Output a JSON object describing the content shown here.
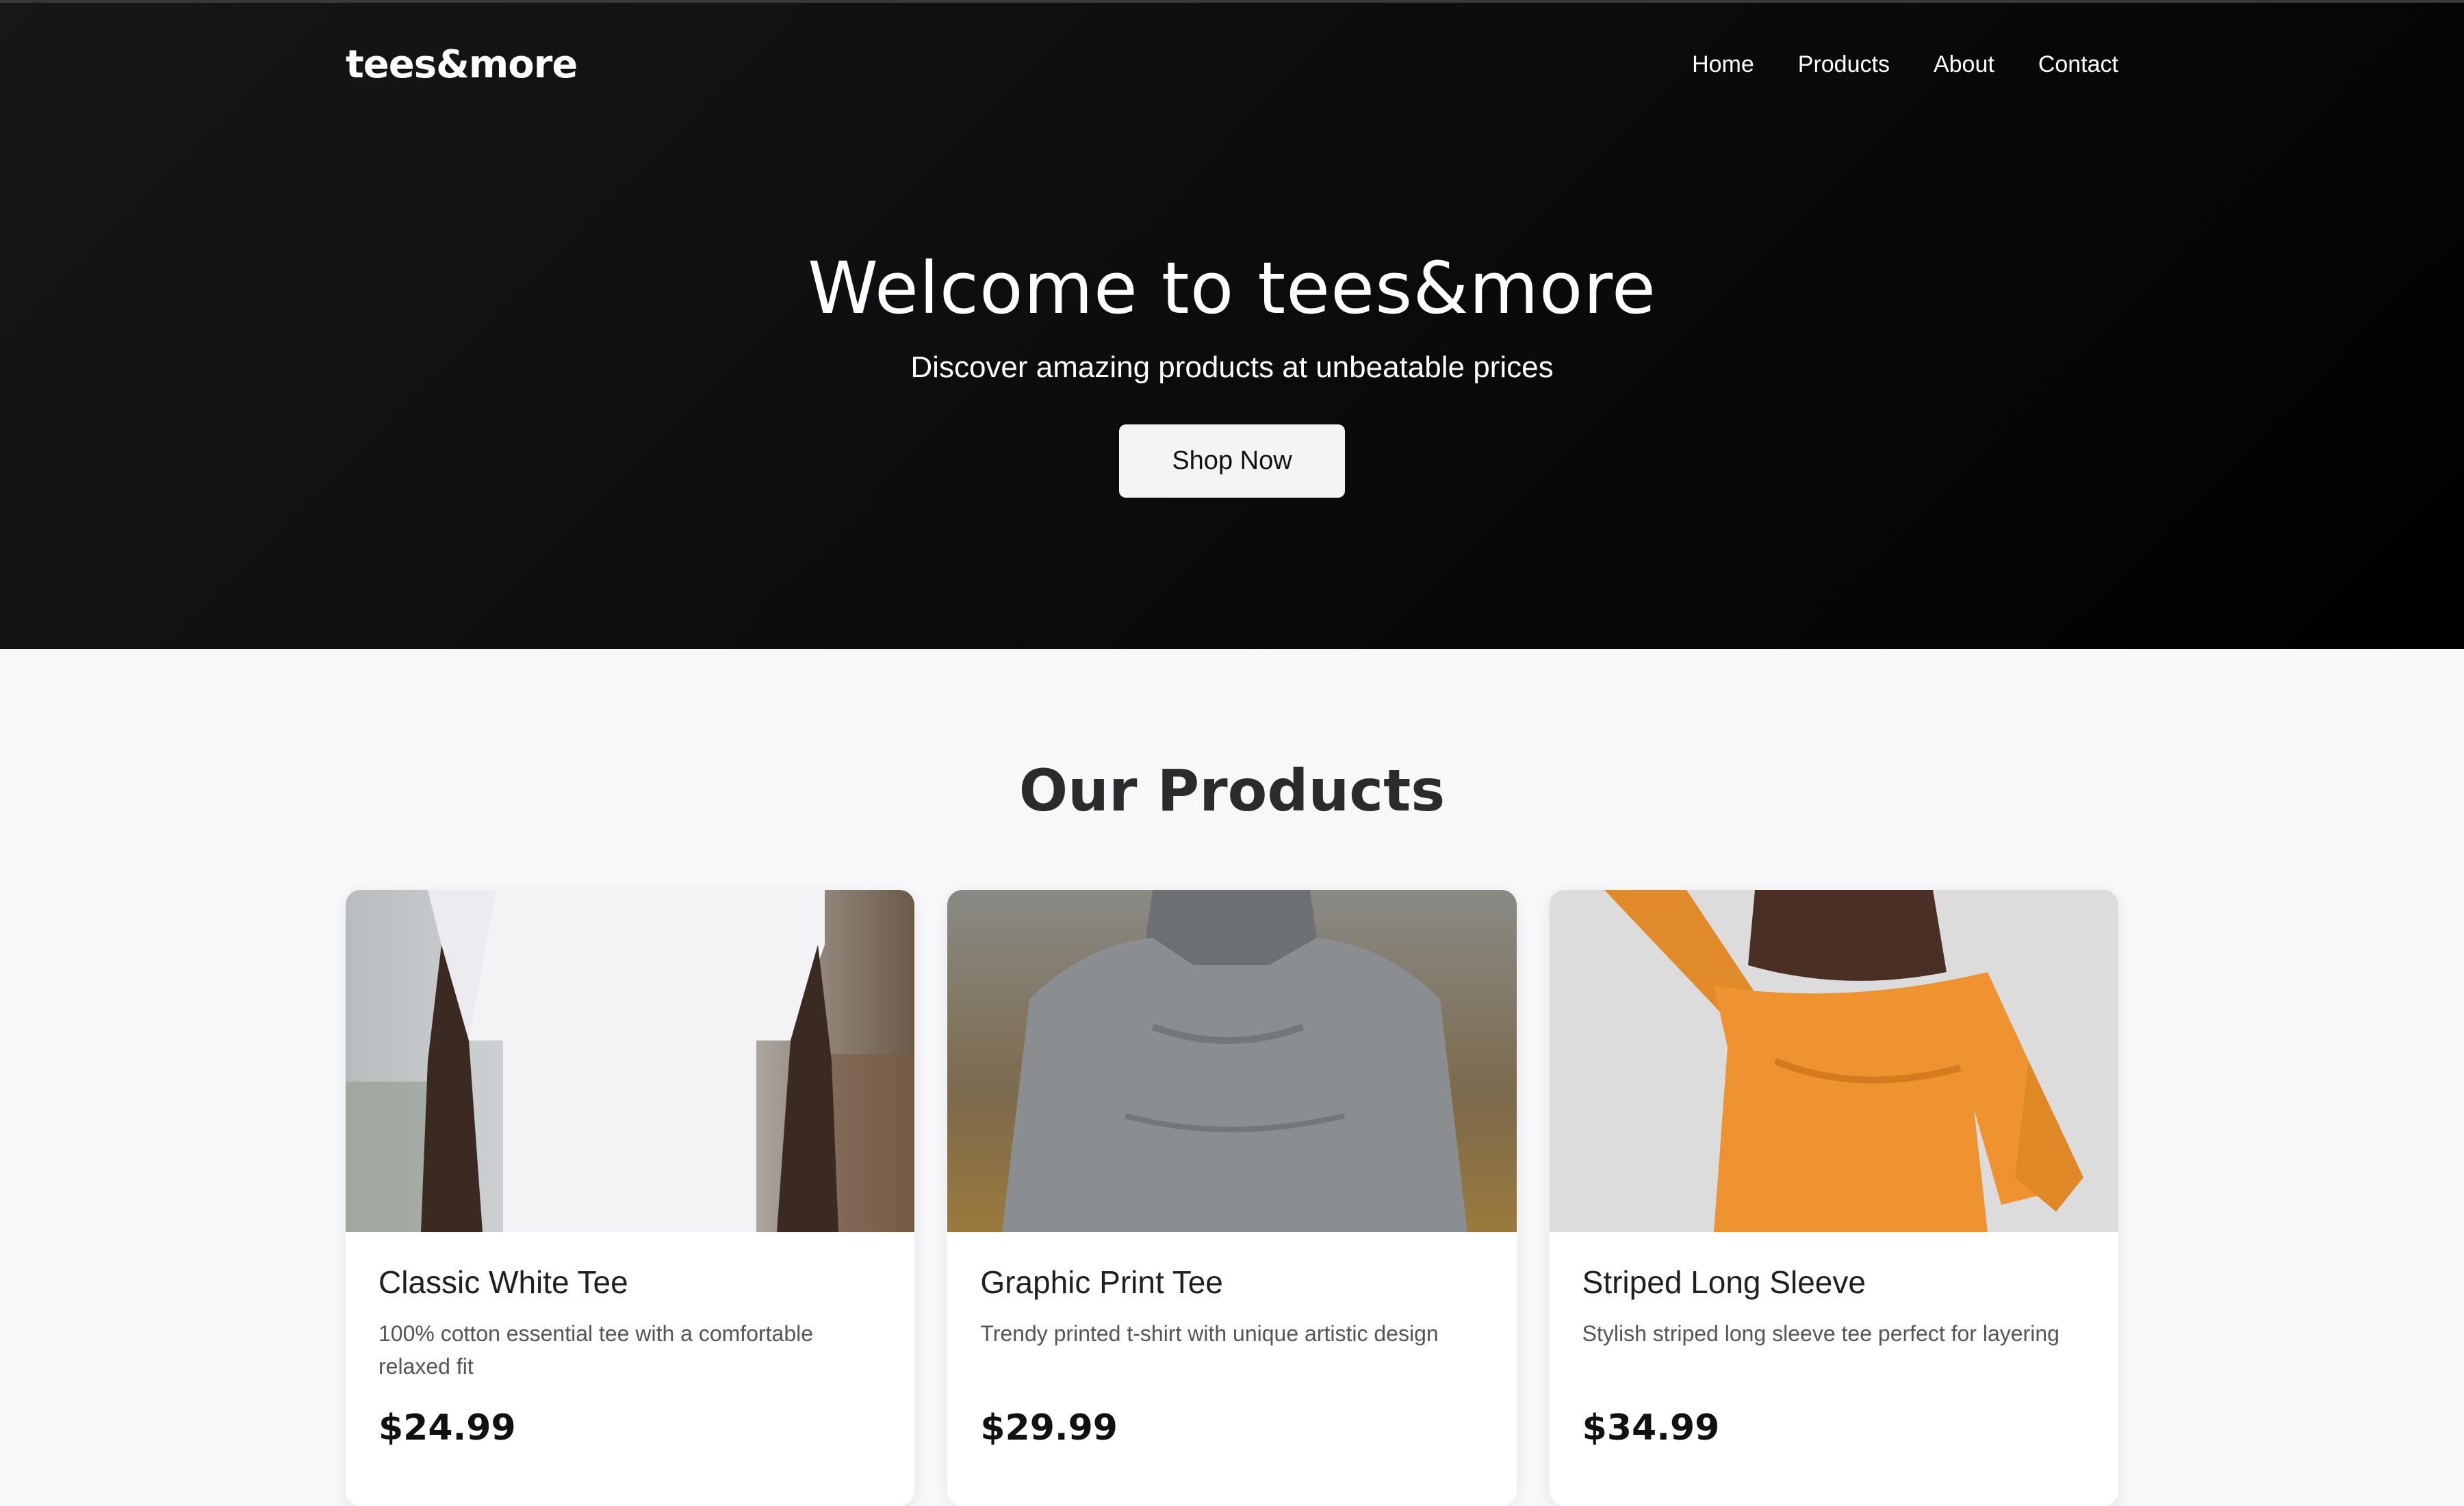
{
  "brand": {
    "logo": "tees&more"
  },
  "nav": {
    "items": [
      "Home",
      "Products",
      "About",
      "Contact"
    ]
  },
  "hero": {
    "title": "Welcome to tees&more",
    "subtitle": "Discover amazing products at unbeatable prices",
    "cta_label": "Shop Now"
  },
  "products": {
    "section_title": "Our Products",
    "items": [
      {
        "name": "Classic White Tee",
        "description": "100% cotton essential tee with a comfortable relaxed fit",
        "price": "$24.99",
        "image_icon": "white-tshirt-photo"
      },
      {
        "name": "Graphic Print Tee",
        "description": "Trendy printed t-shirt with unique artistic design",
        "price": "$29.99",
        "image_icon": "grey-hoodie-photo"
      },
      {
        "name": "Striped Long Sleeve",
        "description": "Stylish striped long sleeve tee perfect for layering",
        "price": "$34.99",
        "image_icon": "orange-sweater-photo"
      }
    ]
  },
  "colors": {
    "hero_bg": "#0b0b0c",
    "page_bg": "#f7f8fa",
    "button_bg": "#f4f4f4",
    "text_dark": "#111111"
  }
}
